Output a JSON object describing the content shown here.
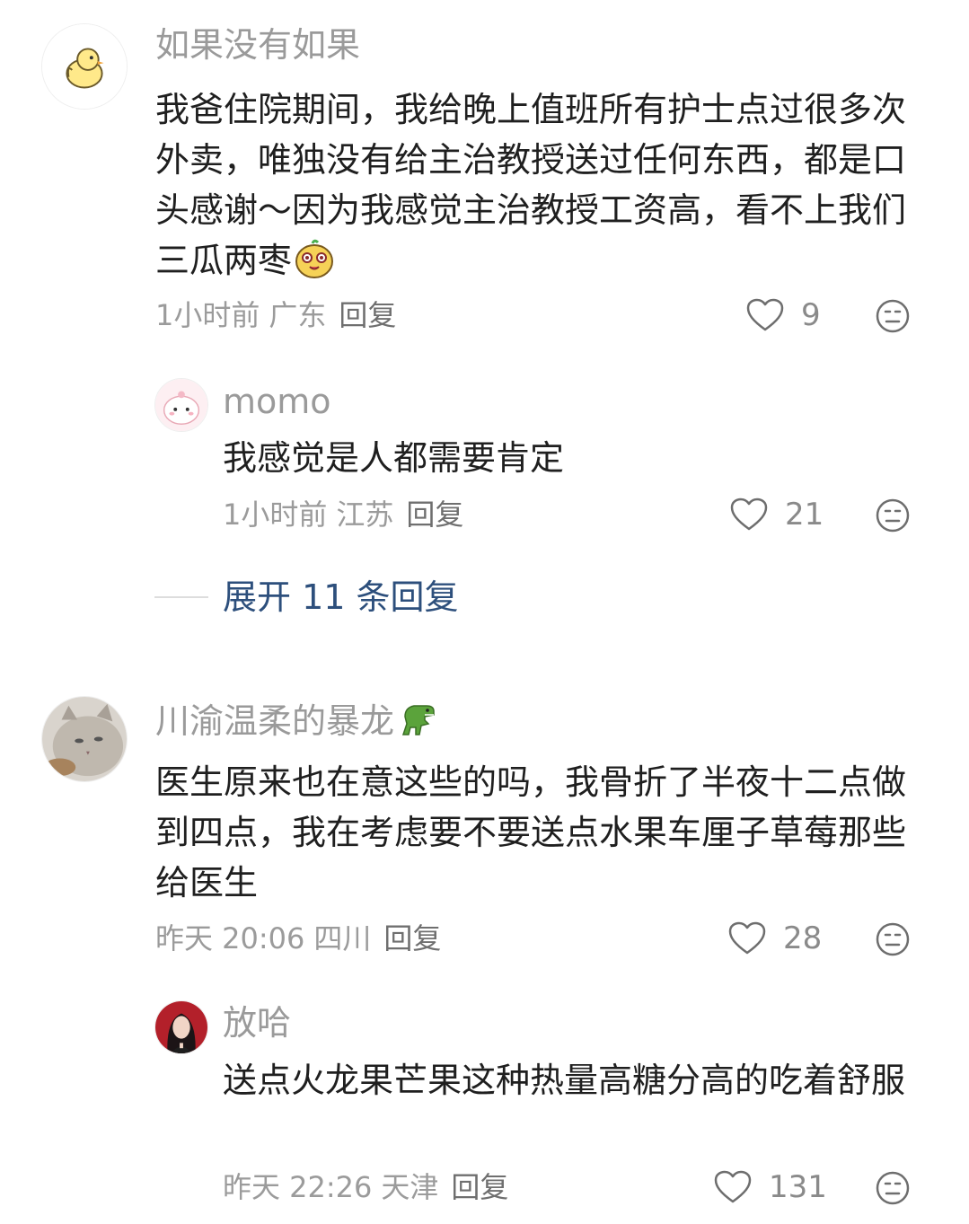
{
  "comments": [
    {
      "username": "如果没有如果",
      "text": "我爸住院期间，我给晚上值班所有护士点过很多次外卖，唯独没有给主治教授送过任何东西，都是口头感谢～因为我感觉主治教授工资高，看不上我们三瓜两枣",
      "time": "1小时前",
      "location": "广东",
      "reply_label": "回复",
      "likes": "9",
      "avatar_icon": "duck-avatar"
    },
    {
      "username": "momo",
      "text": "我感觉是人都需要肯定",
      "time": "1小时前",
      "location": "江苏",
      "reply_label": "回复",
      "likes": "21",
      "avatar_icon": "pink-bunny-avatar"
    },
    {
      "username": "川渝温柔的暴龙",
      "text": "医生原来也在意这些的吗，我骨折了半夜十二点做到四点，我在考虑要不要送点水果车厘子草莓那些给医生",
      "time": "昨天 20:06",
      "location": "四川",
      "reply_label": "回复",
      "likes": "28",
      "avatar_icon": "cat-avatar"
    },
    {
      "username": "放哈",
      "text": "送点火龙果芒果这种热量高糖分高的吃着舒服",
      "time": "昨天 22:26",
      "location": "天津",
      "reply_label": "回复",
      "likes": "131",
      "avatar_icon": "woman-avatar"
    }
  ],
  "expand_replies": "展开 11 条回复",
  "colors": {
    "accent_link": "#2d4f7c",
    "meta_gray": "#9b9b9b",
    "text": "#1f1f1f"
  }
}
